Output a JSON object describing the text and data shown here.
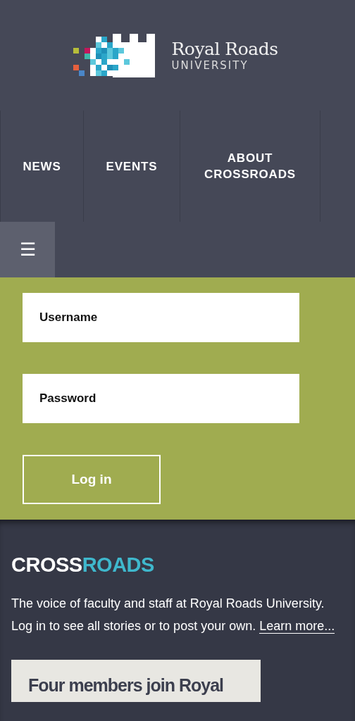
{
  "logo": {
    "name": "Royal Roads",
    "subtitle": "UNIVERSITY"
  },
  "nav": {
    "items": [
      {
        "label": "NEWS"
      },
      {
        "label": "EVENTS"
      },
      {
        "label": "ABOUT CROSSROADS"
      }
    ]
  },
  "menu_button": {
    "icon": "☰",
    "expanded": false
  },
  "login": {
    "username": {
      "placeholder": "Username"
    },
    "password": {
      "placeholder": "Password"
    },
    "button": "Log in"
  },
  "intro": {
    "title": {
      "first": "CROSS",
      "second": "ROADS"
    },
    "text": "The voice of faculty and staff at Royal Roads University. Log in to see all stories or to post your own.",
    "link": "Learn more..."
  },
  "stories": [
    {
      "title": "Four members join Royal"
    }
  ]
}
